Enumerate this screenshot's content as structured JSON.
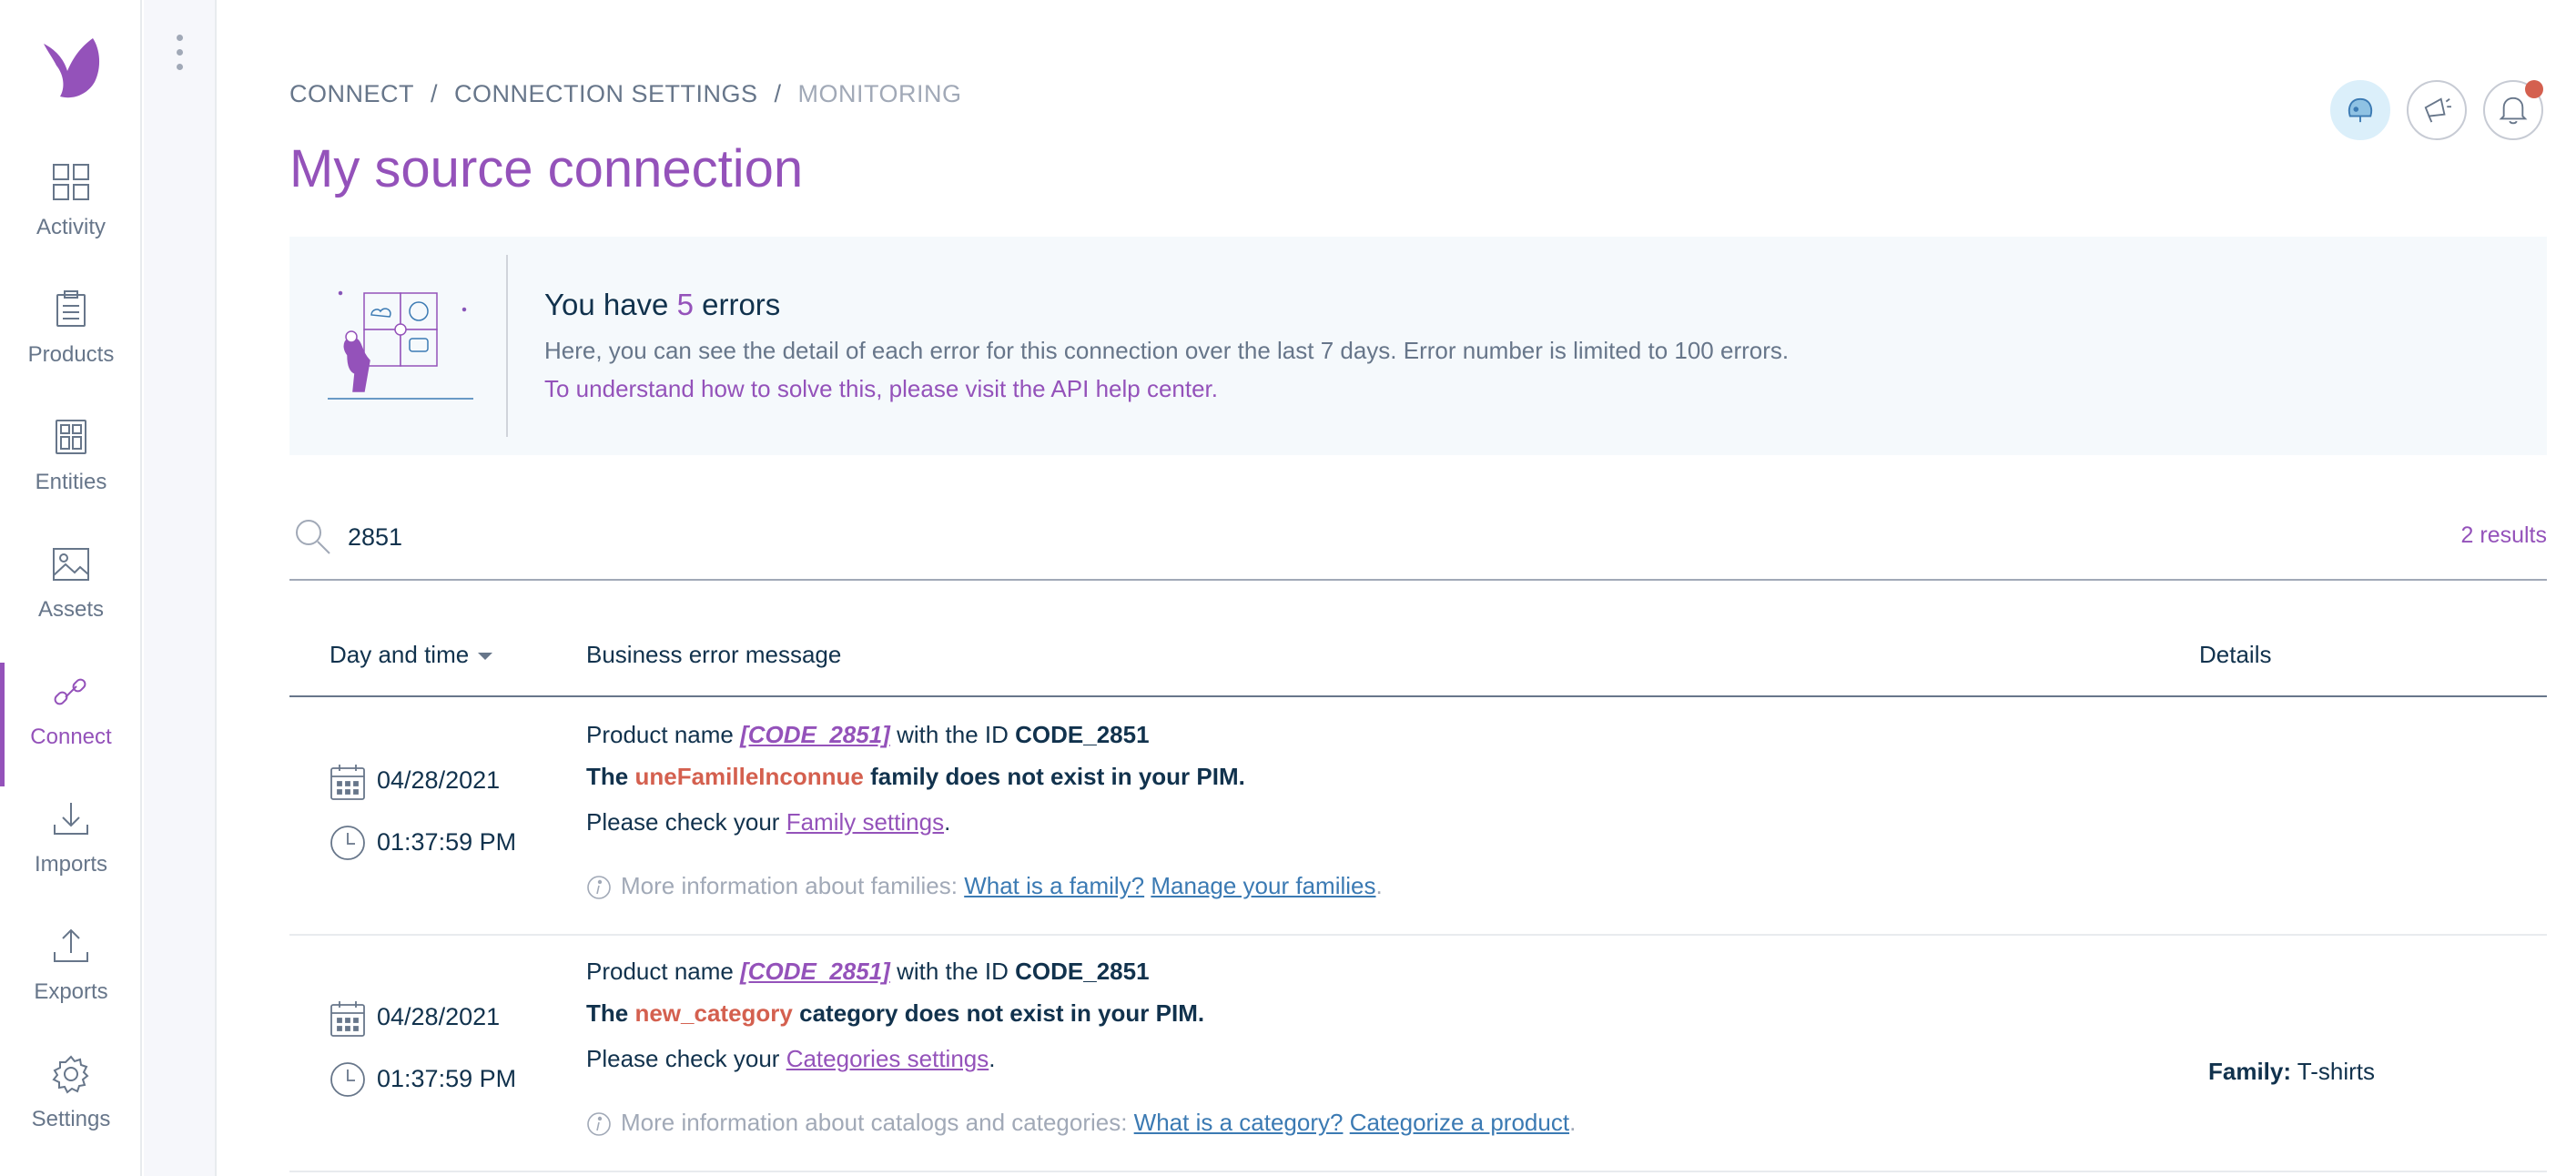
{
  "nav": {
    "items": [
      {
        "label": "Activity",
        "icon": "activity-icon"
      },
      {
        "label": "Products",
        "icon": "products-icon"
      },
      {
        "label": "Entities",
        "icon": "entities-icon"
      },
      {
        "label": "Assets",
        "icon": "assets-icon"
      },
      {
        "label": "Connect",
        "icon": "connect-icon",
        "active": true
      },
      {
        "label": "Imports",
        "icon": "imports-icon"
      },
      {
        "label": "Exports",
        "icon": "exports-icon"
      },
      {
        "label": "Settings",
        "icon": "settings-icon"
      }
    ]
  },
  "breadcrumb": {
    "items": [
      "CONNECT",
      "CONNECTION SETTINGS",
      "MONITORING"
    ],
    "separator": "/"
  },
  "page": {
    "title": "My source connection"
  },
  "helper": {
    "title_prefix": "You have",
    "error_count": "5",
    "title_suffix": "errors",
    "description": "Here, you can see the detail of each error for this connection over the last 7 days. Error number is limited to 100 errors.",
    "link": "To understand how to solve this, please visit the API help center."
  },
  "search": {
    "value": "2851",
    "results": "2 results"
  },
  "table": {
    "columns": {
      "date": "Day and time",
      "message": "Business error message",
      "details": "Details"
    },
    "rows": [
      {
        "date": "04/28/2021",
        "time": "01:37:59 PM",
        "product_prefix": "Product name",
        "product_name": "[CODE_2851]",
        "id_prefix": "with the ID",
        "product_id": "CODE_2851",
        "error_prefix": "The",
        "error_value": "uneFamilleInconnue",
        "error_suffix": "family does not exist in your PIM.",
        "check_prefix": "Please check your",
        "check_link": "Family settings",
        "check_suffix": ".",
        "info_prefix": "More information about families:",
        "info_link1": "What is a family?",
        "info_link2": "Manage your families",
        "info_suffix": ".",
        "details_label": "",
        "details_value": ""
      },
      {
        "date": "04/28/2021",
        "time": "01:37:59 PM",
        "product_prefix": "Product name",
        "product_name": "[CODE_2851]",
        "id_prefix": "with the ID",
        "product_id": "CODE_2851",
        "error_prefix": "The",
        "error_value": "new_category",
        "error_suffix": "category does not exist in your PIM.",
        "check_prefix": "Please check your",
        "check_link": "Categories settings",
        "check_suffix": ".",
        "info_prefix": "More information about catalogs and categories:",
        "info_link1": "What is a category?",
        "info_link2": "Categorize a product",
        "info_suffix": ".",
        "details_label": "Family:",
        "details_value": "T-shirts"
      }
    ]
  },
  "colors": {
    "accent": "#9452ba",
    "error": "#d4604f",
    "text": "#11324d",
    "muted": "#67768a",
    "link_blue": "#3b7ab3"
  }
}
